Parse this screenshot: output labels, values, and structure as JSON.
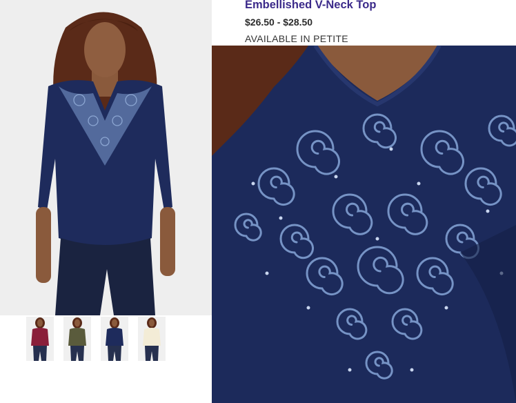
{
  "product": {
    "title": "Embellished V-Neck Top",
    "price": "$26.50 - $28.50",
    "availability": "AVAILABLE IN PETITE"
  },
  "main_image": {
    "shirt_color": "#1e2b5c",
    "print_color": "#7f9ed2",
    "hair_color": "#5a2a18",
    "skin_color": "#8a5a3c",
    "background": "#eeeeee"
  },
  "color_swatches": [
    {
      "color": "#8a1f3a"
    },
    {
      "color": "#5a5b3c"
    },
    {
      "color": "#1e2b5c"
    },
    {
      "color": "#f3ecd6"
    }
  ],
  "zoom_image": {
    "shirt_color": "#1c2a5b",
    "print_color": "#86a6d8"
  }
}
